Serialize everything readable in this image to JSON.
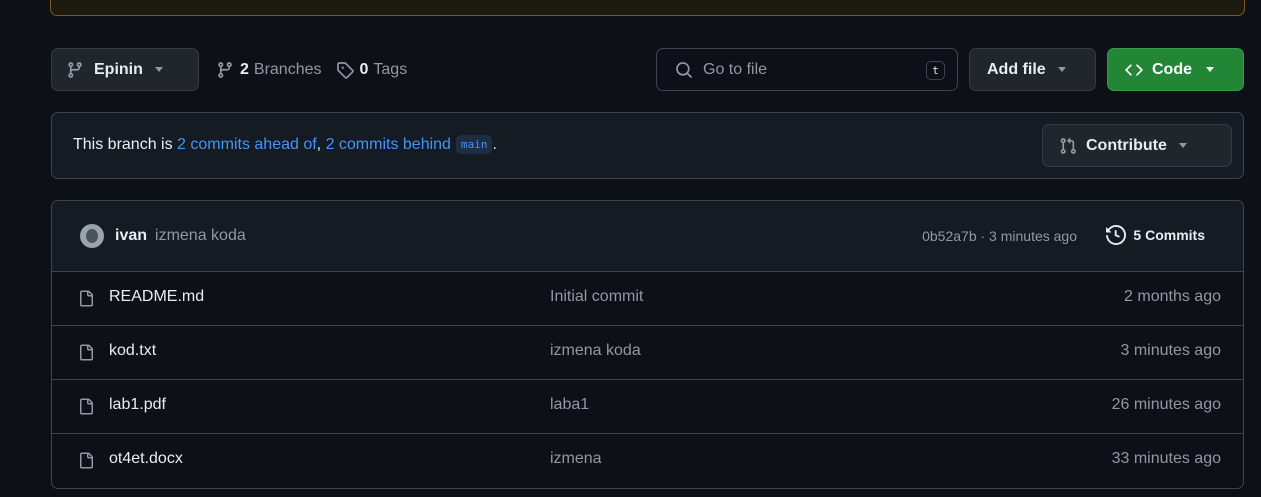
{
  "toolbar": {
    "branch_name": "Epinin",
    "branches_count": "2",
    "branches_label": "Branches",
    "tags_count": "0",
    "tags_label": "Tags",
    "search_placeholder": "Go to file",
    "search_shortcut": "t",
    "add_file_label": "Add file",
    "code_label": "Code"
  },
  "branch_status": {
    "prefix": "This branch is ",
    "ahead_link": "2 commits ahead of",
    "separator": ", ",
    "behind_link": "2 commits behind",
    "base_branch": "main",
    "suffix": ".",
    "contribute_label": "Contribute"
  },
  "latest_commit": {
    "author": "ivan",
    "message": "izmena koda",
    "hash_time": "0b52a7b · 3 minutes ago",
    "commits_label": "5 Commits"
  },
  "files": [
    {
      "name": "README.md",
      "message": "Initial commit",
      "time": "2 months ago"
    },
    {
      "name": "kod.txt",
      "message": "izmena koda",
      "time": "3 minutes ago"
    },
    {
      "name": "lab1.pdf",
      "message": "laba1",
      "time": "26 minutes ago"
    },
    {
      "name": "ot4et.docx",
      "message": "izmena",
      "time": "33 minutes ago"
    }
  ],
  "colors": {
    "background": "#0d1117",
    "link": "#4493f8",
    "code_button": "#238636",
    "border": "#3d444d"
  }
}
